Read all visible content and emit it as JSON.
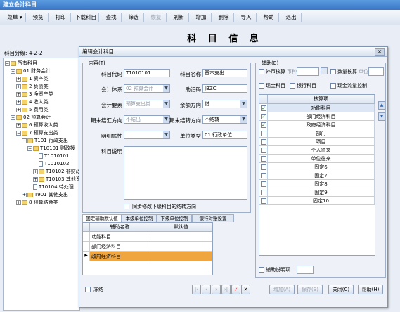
{
  "app": {
    "title": "建立会计科目"
  },
  "toolbar": [
    {
      "label": "菜单 ▾",
      "disabled": false
    },
    {
      "label": "预览",
      "disabled": false
    },
    {
      "label": "打印",
      "disabled": false
    },
    {
      "label": "下载科目",
      "disabled": false
    },
    {
      "label": "查找",
      "disabled": false
    },
    {
      "label": "筛选",
      "disabled": false
    },
    {
      "label": "恢复",
      "disabled": true
    },
    {
      "label": "刷新",
      "disabled": false
    },
    {
      "label": "增加",
      "disabled": false
    },
    {
      "label": "删除",
      "disabled": false
    },
    {
      "label": "导入",
      "disabled": false
    },
    {
      "label": "帮助",
      "disabled": false
    },
    {
      "label": "退出",
      "disabled": false
    }
  ],
  "page_title": "科 目 信 息",
  "grading": "科目分级: 4-2-2",
  "tree": [
    {
      "label": "所有科目",
      "type": "folder",
      "pm": "−"
    },
    {
      "label": "01 财务会计",
      "type": "folder",
      "pm": "−"
    },
    {
      "label": "1 资产类",
      "type": "folder",
      "pm": "+"
    },
    {
      "label": "2 负债类",
      "type": "folder",
      "pm": "+"
    },
    {
      "label": "3 净资产类",
      "type": "folder",
      "pm": "+"
    },
    {
      "label": "4 收入类",
      "type": "folder",
      "pm": "+"
    },
    {
      "label": "5 费用类",
      "type": "folder",
      "pm": "+"
    },
    {
      "label": "02 预算会计",
      "type": "folder",
      "pm": "−"
    },
    {
      "label": "6 预算收入类",
      "type": "folder",
      "pm": "+"
    },
    {
      "label": "7 预算支出类",
      "type": "folder",
      "pm": "−"
    },
    {
      "label": "T101 行政支出",
      "type": "folder",
      "pm": "−"
    },
    {
      "label": "T10101 财政拨",
      "type": "folder",
      "pm": "−"
    },
    {
      "label": "T1010101",
      "type": "doc",
      "pm": ""
    },
    {
      "label": "T1010102",
      "type": "doc",
      "pm": ""
    },
    {
      "label": "T10102 非财政",
      "type": "folder",
      "pm": "+"
    },
    {
      "label": "T10103 其他资",
      "type": "folder",
      "pm": "+"
    },
    {
      "label": "T10104 待处理",
      "type": "doc",
      "pm": ""
    },
    {
      "label": "T901 其他支出",
      "type": "folder",
      "pm": "+"
    },
    {
      "label": "8 预算结余类",
      "type": "folder",
      "pm": "+"
    }
  ],
  "dialog": {
    "title": "编辑会计科目",
    "close": "×",
    "content_group": "内容(T)",
    "fields": {
      "code_label": "科目代码",
      "code_value": "T1010101",
      "name_label": "科目名称",
      "name_value": "基本支出",
      "system_label": "会计体系",
      "system_value": "02 预算会计",
      "mnemonic_label": "助记码",
      "mnemonic_value": "JBZC",
      "element_label": "会计要素",
      "element_value": "预算支出类",
      "balance_label": "余额方向",
      "balance_value": "借",
      "carry_end_label": "期末结汇方向",
      "carry_end_value": "不结出",
      "carry_year_label": "期末结转方向",
      "carry_year_value": "不结转",
      "detail_label": "明细属性",
      "detail_value": "",
      "unit_type_label": "单位类型",
      "unit_type_value": "01 行政单位",
      "desc_label": "科目说明",
      "desc_value": ""
    },
    "sync_check": "同步修改下级科目的结转方向",
    "tabs": [
      "固定辅助默认值",
      "本级单位控制",
      "下级单位控制",
      "银行对账设置"
    ],
    "default_grid": {
      "headers": [
        "辅助名称",
        "默认值"
      ],
      "rows": [
        {
          "name": "功能科目",
          "value": ""
        },
        {
          "name": "部门经济科目",
          "value": ""
        },
        {
          "name": "政府经济科目",
          "value": ""
        }
      ]
    },
    "freeze_check": "冻结",
    "aux": {
      "group": "辅助(B)",
      "foreign_check": "外币核算",
      "currency_label": "币种",
      "qty_check": "数量核算",
      "unit_label": "单位",
      "cash_check": "现金科目",
      "bank_check": "银行科目",
      "cashflow_check": "现金流量控制",
      "grid_header": "核算项",
      "items": [
        {
          "label": "功能科目",
          "checked": true
        },
        {
          "label": "部门经济科目",
          "checked": true
        },
        {
          "label": "政府经济科目",
          "checked": true
        },
        {
          "label": "部门",
          "checked": false
        },
        {
          "label": "项目",
          "checked": false
        },
        {
          "label": "个人往来",
          "checked": false
        },
        {
          "label": "单位往来",
          "checked": false
        },
        {
          "label": "固定6",
          "checked": false
        },
        {
          "label": "固定7",
          "checked": false
        },
        {
          "label": "固定8",
          "checked": false
        },
        {
          "label": "固定9",
          "checked": false
        },
        {
          "label": "固定10",
          "checked": false
        }
      ],
      "desc_check": "辅助说明项"
    },
    "nav_buttons": [
      "|‹",
      "‹",
      "›",
      "›|",
      "✓",
      "✕"
    ],
    "buttons": {
      "add": "增加(A)",
      "save": "保存(S)",
      "close": "关闭(C)",
      "help": "帮助(H)"
    }
  },
  "colors": {
    "title_bar": "#3a76c6",
    "selected_row": "#f0a640",
    "check_red": "#d42a2a"
  }
}
